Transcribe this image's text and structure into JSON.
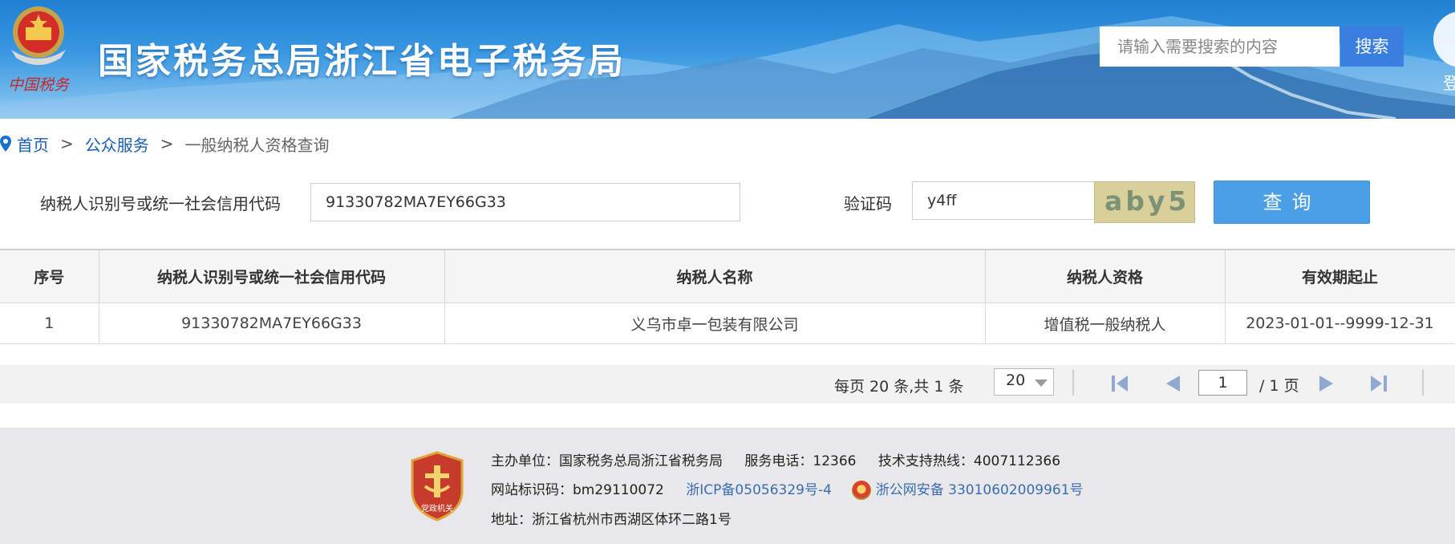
{
  "header": {
    "title": "国家税务总局浙江省电子税务局",
    "logo_caption": "中国税务",
    "search_placeholder": "请输入需要搜索的内容",
    "search_button": "搜索",
    "login_label": "登"
  },
  "breadcrumb": {
    "home": "首页",
    "section": "公众服务",
    "current": "一般纳税人资格查询",
    "separator": ">"
  },
  "form": {
    "taxpayer_id_label": "纳税人识别号或统一社会信用代码",
    "taxpayer_id_value": "91330782MA7EY66G33",
    "captcha_label": "验证码",
    "captcha_value": "y4ff",
    "captcha_image_text": "aby5",
    "query_button": "查询"
  },
  "table": {
    "columns": [
      "序号",
      "纳税人识别号或统一社会信用代码",
      "纳税人名称",
      "纳税人资格",
      "有效期起止"
    ],
    "rows": [
      [
        "1",
        "91330782MA7EY66G33",
        "义乌市卓一包装有限公司",
        "增值税一般纳税人",
        "2023-01-01--9999-12-31"
      ]
    ]
  },
  "pager": {
    "summary": "每页 20 条,共 1 条",
    "page_size": "20",
    "current_page": "1",
    "total_pages": "/ 1 页"
  },
  "footer": {
    "sponsor": "主办单位：国家税务总局浙江省税务局",
    "service_phone": "服务电话：12366",
    "support_hotline": "技术支持热线：4007112366",
    "site_code": "网站标识码：bm29110072",
    "icp": "浙ICP备05056329号-4",
    "police_record": "浙公网安备 33010602009961号",
    "address": "地址：浙江省杭州市西湖区体环二路1号",
    "badge_text": "党政机关"
  },
  "colors": {
    "banner_blue": "#2b8ad8",
    "link_blue": "#1a5fb4",
    "query_button": "#4a9fe5",
    "footer_bg": "#e8e8ea"
  }
}
